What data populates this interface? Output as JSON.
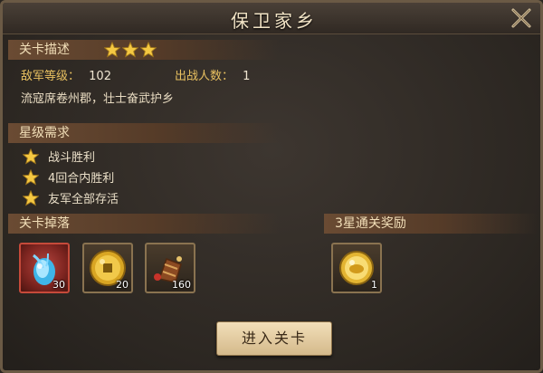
{
  "window": {
    "title": "保卫家乡"
  },
  "description": {
    "header": "关卡描述",
    "stars": 3,
    "enemy_level_label": "敌军等级：",
    "enemy_level_value": "102",
    "troops_label": "出战人数：",
    "troops_value": "1",
    "story": "流寇席卷州郡，壮士奋武护乡"
  },
  "requirements": {
    "header": "星级需求",
    "items": [
      {
        "label": "战斗胜利"
      },
      {
        "label": "4回合内胜利"
      },
      {
        "label": "友军全部存活"
      }
    ]
  },
  "drops": {
    "header": "关卡掉落",
    "items": [
      {
        "icon": "blue-crystal-icon",
        "count": "30"
      },
      {
        "icon": "gold-coin-icon",
        "count": "20"
      },
      {
        "icon": "treasure-bundle-icon",
        "count": "160"
      }
    ]
  },
  "reward": {
    "header": "3星通关奖励",
    "items": [
      {
        "icon": "gold-ingot-icon",
        "count": "1"
      }
    ]
  },
  "actions": {
    "enter_label": "进入关卡"
  },
  "colors": {
    "star": "#f5c842",
    "accent_gold": "#e8c060",
    "section_bg": "#6a4b33"
  }
}
